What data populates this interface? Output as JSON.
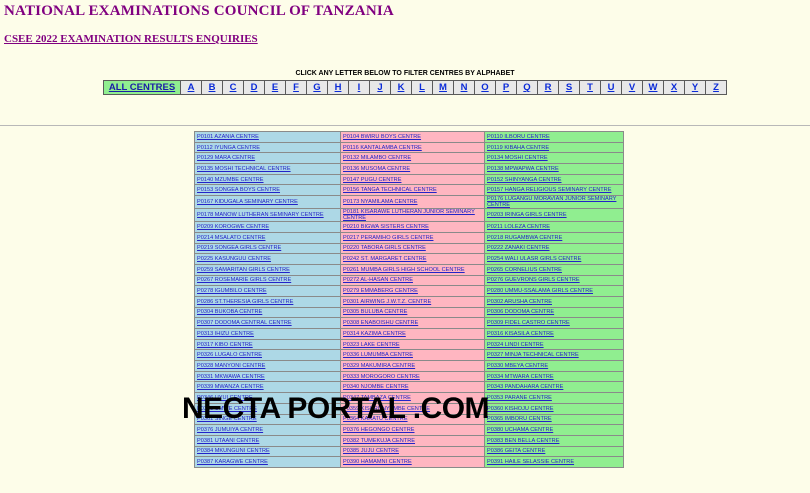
{
  "header": {
    "title": "NATIONAL EXAMINATIONS COUNCIL OF TANZANIA",
    "results_link": "CSEE 2022 EXAMINATION RESULTS ENQUIRIES"
  },
  "filter": {
    "instruction": "CLICK ANY LETTER BELOW TO FILTER CENTRES BY ALPHABET",
    "all_label": "ALL CENTRES",
    "letters": [
      "A",
      "B",
      "C",
      "D",
      "E",
      "F",
      "G",
      "H",
      "I",
      "J",
      "K",
      "L",
      "M",
      "N",
      "O",
      "P",
      "Q",
      "R",
      "S",
      "T",
      "U",
      "V",
      "W",
      "X",
      "Y",
      "Z"
    ]
  },
  "colors": {
    "column1": "#add8e6",
    "column2": "#ffb6c1",
    "column3": "#90ee90",
    "title": "#800080",
    "link": "#2323c8"
  },
  "centres": [
    [
      "P0101 AZANIA CENTRE",
      "P0104 BWIRU BOYS CENTRE",
      "P0110 ILBORU CENTRE"
    ],
    [
      "P0112 IYUNGA CENTRE",
      "P0116 KANTALAMBA CENTRE",
      "P0119 KIBAHA CENTRE"
    ],
    [
      "P0129 MARA CENTRE",
      "P0132 MILAMBO CENTRE",
      "P0134 MOSHI CENTRE"
    ],
    [
      "P0135 MOSHI TECHNICAL CENTRE",
      "P0136 MUSOMA CENTRE",
      "P0138 MPWAPWA CENTRE"
    ],
    [
      "P0140 MZUMBE CENTRE",
      "P0147 PUGU CENTRE",
      "P0152 SHINYANGA CENTRE"
    ],
    [
      "P0153 SONGEA BOYS CENTRE",
      "P0156 TANGA TECHNICAL CENTRE",
      "P0157 HANGA RELIGIOUS SEMINARY CENTRE"
    ],
    [
      "P0167 KIDUGALA SEMINARY CENTRE",
      "P0173 NYAMILAMA CENTRE",
      "P0176 LUGANGU MORAVIAN JUNIOR SEMINARY CENTRE"
    ],
    [
      "P0178 MANOW LUTHERAN SEMINARY CENTRE",
      "P0181 KISARAWE LUTHERAN JUNIOR SEMINARY CENTRE",
      "P0203 IRINGA GIRLS CENTRE"
    ],
    [
      "P0209 KOROGWE CENTRE",
      "P0210 BIGWA SISTERS CENTRE",
      "P0211 LOLEZA CENTRE"
    ],
    [
      "P0214 MSALATO CENTRE",
      "P0217 PERAMIHO GIRLS CENTRE",
      "P0218 RUGAMBWA CENTRE"
    ],
    [
      "P0219 SONGEA GIRLS CENTRE",
      "P0220 TABORA GIRLS CENTRE",
      "P0222 ZANAKI CENTRE"
    ],
    [
      "P0225 KASUNGUU CENTRE",
      "P0242 ST. MARGARET CENTRE",
      "P0254 WALI ULASR GIRLS CENTRE"
    ],
    [
      "P0259 SAMARITAN GIRLS CENTRE",
      "P0261 MUMBA GIRLS HIGH SCHOOL CENTRE",
      "P0265 CORNELIUS CENTRE"
    ],
    [
      "P0267 ROSEMARIE GIRLS CENTRE",
      "P0272 AL-HASAN CENTRE",
      "P0276 GUEVRONS GIRLS CENTRE"
    ],
    [
      "P0278 IGUMBILO CENTRE",
      "P0279 EMMABERG CENTRE",
      "P0280 UMMU-SSALAMA GIRLS CENTRE"
    ],
    [
      "P0286 ST.THERESIA GIRLS CENTRE",
      "P0301 AIRWING J.W.T.Z. CENTRE",
      "P0302 ARUSHA CENTRE"
    ],
    [
      "P0304 BUKOBA CENTRE",
      "P0305 BULUBA CENTRE",
      "P0306 DODOMA CENTRE"
    ],
    [
      "P0307 DODOMA CENTRAL CENTRE",
      "P0308 ENABOISHU CENTRE",
      "P0309 FIDEL CASTRO CENTRE"
    ],
    [
      "P0313 IHIZU CENTRE",
      "P0314 KAZIMA CENTRE",
      "P0316 KISASILA CENTRE"
    ],
    [
      "P0317 KIBO CENTRE",
      "P0323 LAKE CENTRE",
      "P0324 LINDI CENTRE"
    ],
    [
      "P0326 LUGALO CENTRE",
      "P0336 LUMUMBA CENTRE",
      "P0327 MINJA TECHNICAL CENTRE"
    ],
    [
      "P0328 MANYONI CENTRE",
      "P0329 MAKUMIRA CENTRE",
      "P0330 MBEYA CENTRE"
    ],
    [
      "P0331 MKWAWA CENTRE",
      "P0333 MOROGORO CENTRE",
      "P0334 MTWARA CENTRE"
    ],
    [
      "P0339 MWANZA CENTRE",
      "P0340 NJOMBE CENTRE",
      "P0343 PANDAHARA CENTRE"
    ],
    [
      "P0346 UYUI CENTRE",
      "P0347 TAMBAZA CENTRE",
      "P0353 PARANE CENTRE"
    ],
    [
      "P0355 UMWE CENTRE",
      "P0359 KISURUNYEMBE CENTRE",
      "P0360 KISHOJU CENTRE"
    ],
    [
      "P0361 SINGE CENTRE",
      "P0364 KARATU CENTRE",
      "P0365 IMBORU CENTRE"
    ],
    [
      "P0376 JUMUIYA CENTRE",
      "P0376 HEGONGO CENTRE",
      "P0380 UCHAMA CENTRE"
    ],
    [
      "P0381 UTAANI CENTRE",
      "P0382 TUMEKUJA CENTRE",
      "P0383 BEN BELLA CENTRE"
    ],
    [
      "P0384 MKUNGUNI CENTRE",
      "P0385 JUJU CENTRE",
      "P0386 GEITA CENTRE"
    ],
    [
      "P0387 KARAGWE CENTRE",
      "P0390 HAMAMNI CENTRE",
      "P0391 HAILE SELASSIE CENTRE"
    ]
  ],
  "watermark": {
    "text": "NECTA PORTAL .COM"
  }
}
